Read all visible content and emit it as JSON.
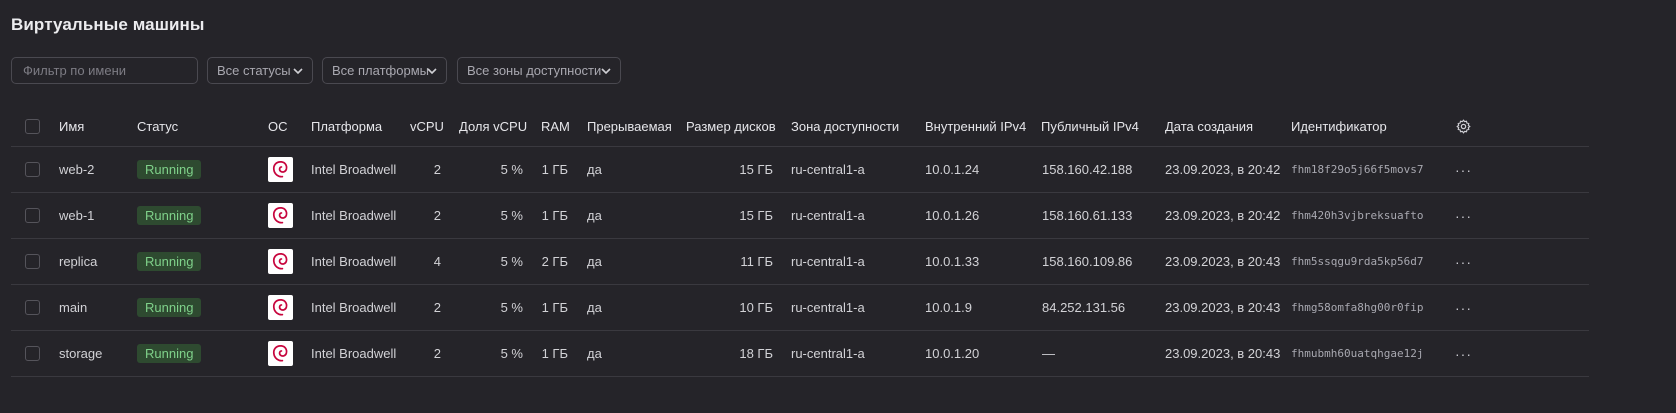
{
  "page": {
    "title": "Виртуальные машины"
  },
  "filters": {
    "name_placeholder": "Фильтр по имени",
    "status_select": "Все статусы",
    "platform_select": "Все платформы",
    "zone_select": "Все зоны доступности"
  },
  "table": {
    "columns": [
      "Имя",
      "Статус",
      "ОС",
      "Платформа",
      "vCPU",
      "Доля vCPU",
      "RAM",
      "Прерываемая",
      "Размер дисков",
      "Зона доступности",
      "Внутренний IPv4",
      "Публичный IPv4",
      "Дата создания",
      "Идентификатор"
    ],
    "rows": [
      {
        "name": "web-2",
        "status": "Running",
        "os_icon": "debian-icon",
        "platform": "Intel Broadwell",
        "vcpu": "2",
        "vcpu_share": "5 %",
        "ram": "1 ГБ",
        "preemptible": "да",
        "disk": "15 ГБ",
        "zone": "ru-central1-a",
        "internal_ip": "10.0.1.24",
        "public_ip": "158.160.42.188",
        "created": "23.09.2023, в 20:42",
        "id": "fhm18f29o5j66f5movs7"
      },
      {
        "name": "web-1",
        "status": "Running",
        "os_icon": "debian-icon",
        "platform": "Intel Broadwell",
        "vcpu": "2",
        "vcpu_share": "5 %",
        "ram": "1 ГБ",
        "preemptible": "да",
        "disk": "15 ГБ",
        "zone": "ru-central1-a",
        "internal_ip": "10.0.1.26",
        "public_ip": "158.160.61.133",
        "created": "23.09.2023, в 20:42",
        "id": "fhm420h3vjbreksuafto"
      },
      {
        "name": "replica",
        "status": "Running",
        "os_icon": "debian-icon",
        "platform": "Intel Broadwell",
        "vcpu": "4",
        "vcpu_share": "5 %",
        "ram": "2 ГБ",
        "preemptible": "да",
        "disk": "11 ГБ",
        "zone": "ru-central1-a",
        "internal_ip": "10.0.1.33",
        "public_ip": "158.160.109.86",
        "created": "23.09.2023, в 20:43",
        "id": "fhm5ssqgu9rda5kp56d7"
      },
      {
        "name": "main",
        "status": "Running",
        "os_icon": "debian-icon",
        "platform": "Intel Broadwell",
        "vcpu": "2",
        "vcpu_share": "5 %",
        "ram": "1 ГБ",
        "preemptible": "да",
        "disk": "10 ГБ",
        "zone": "ru-central1-a",
        "internal_ip": "10.0.1.9",
        "public_ip": "84.252.131.56",
        "created": "23.09.2023, в 20:43",
        "id": "fhmg58omfa8hg00r0fip"
      },
      {
        "name": "storage",
        "status": "Running",
        "os_icon": "debian-icon",
        "platform": "Intel Broadwell",
        "vcpu": "2",
        "vcpu_share": "5 %",
        "ram": "1 ГБ",
        "preemptible": "да",
        "disk": "18 ГБ",
        "zone": "ru-central1-a",
        "internal_ip": "10.0.1.20",
        "public_ip": "—",
        "created": "23.09.2023, в 20:43",
        "id": "fhmubmh60uatqhgae12j"
      }
    ],
    "row_menu": "···"
  },
  "colors": {
    "background": "#252429",
    "status_running_bg": "#2e4a30",
    "status_running_text": "#7fd18a",
    "border": "#3a393f"
  }
}
